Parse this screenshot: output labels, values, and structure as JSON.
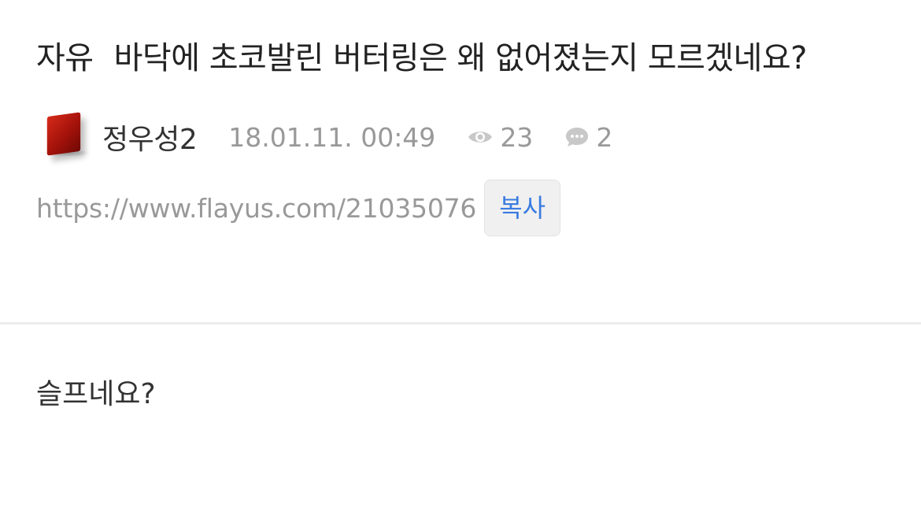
{
  "post": {
    "category": "자유",
    "title": "바닥에 초코발린 버터링은 왜 없어졌는지 모르겠네요?",
    "author": "정우성2",
    "date": "18.01.11. 00:49",
    "views": "23",
    "comments": "2",
    "url": "https://www.flayus.com/21035076",
    "copy_label": "복사",
    "body": "슬프네요?"
  },
  "icons": {
    "views": "eye-icon",
    "comments": "speech-bubble-icon",
    "avatar": "red-book-avatar"
  },
  "colors": {
    "accent": "#3a7ce0",
    "muted": "#999999",
    "text": "#222222",
    "avatar": "#b8180c"
  }
}
